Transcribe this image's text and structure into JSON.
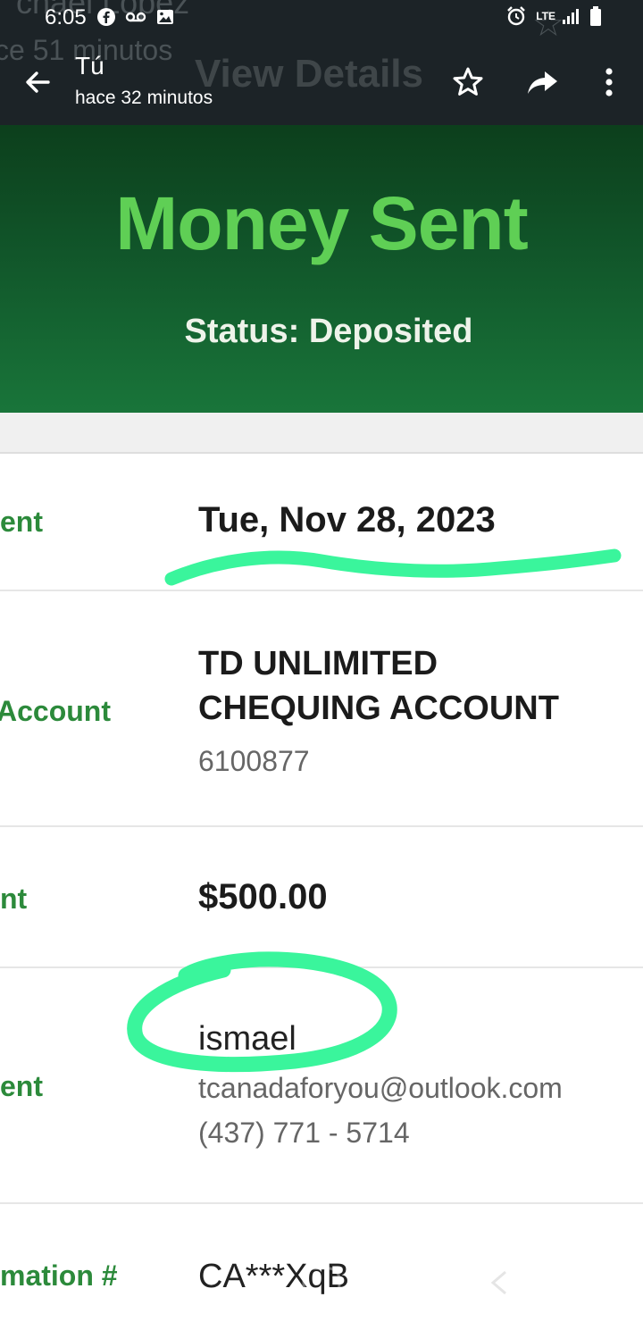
{
  "background_thread": {
    "name_fragment": "chael Lopez",
    "time_fragment": "ce 51 minutos",
    "view_details": "View Details"
  },
  "status_bar": {
    "time": "6:05",
    "network": "LTE"
  },
  "app_bar": {
    "sender": "Tú",
    "timestamp": "hace 32 minutos",
    "icons": [
      "back-arrow-icon",
      "star-outline-icon",
      "share-icon",
      "more-vert-icon"
    ]
  },
  "banner": {
    "title": "Money Sent",
    "status": "Status: Deposited",
    "colors": {
      "background": "#11562a",
      "title": "#5fcf55",
      "label": "#2c8a3b",
      "highlight": "#3af59c"
    }
  },
  "details": {
    "date": {
      "label": "ent",
      "value": "Tue, Nov 28, 2023"
    },
    "account": {
      "label": "Account",
      "line1": "TD UNLIMITED",
      "line2": "CHEQUING ACCOUNT",
      "number": "6100877"
    },
    "amount": {
      "label": "nt",
      "value": "$500.00"
    },
    "recipient": {
      "label": "ent",
      "name": "ismael",
      "email": "tcanadaforyou@outlook.com",
      "phone": "(437) 771 - 5714"
    },
    "confirmation": {
      "label": "mation #",
      "value": "CA***XqB"
    }
  }
}
